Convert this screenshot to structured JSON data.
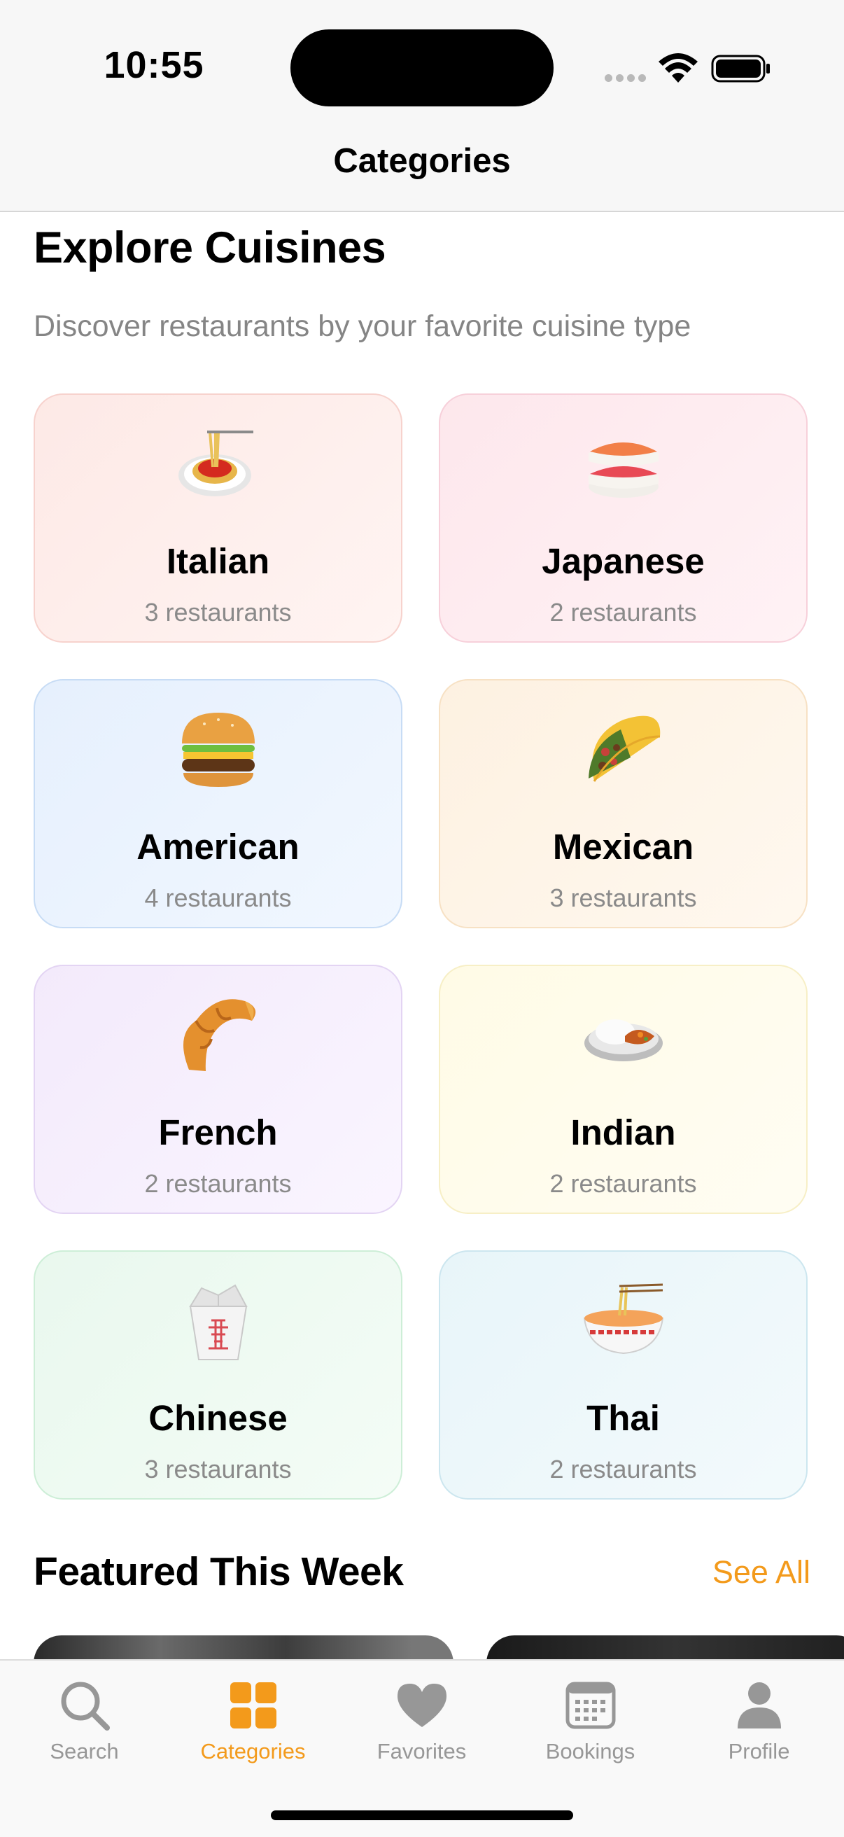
{
  "status_bar": {
    "time": "10:55"
  },
  "nav": {
    "title": "Categories"
  },
  "section": {
    "title": "Explore Cuisines",
    "subtitle": "Discover restaurants by your favorite cuisine type"
  },
  "cuisines": [
    {
      "name": "Italian",
      "count": "3 restaurants",
      "icon": "spaghetti-icon"
    },
    {
      "name": "Japanese",
      "count": "2 restaurants",
      "icon": "sushi-icon"
    },
    {
      "name": "American",
      "count": "4 restaurants",
      "icon": "hamburger-icon"
    },
    {
      "name": "Mexican",
      "count": "3 restaurants",
      "icon": "taco-icon"
    },
    {
      "name": "French",
      "count": "2 restaurants",
      "icon": "croissant-icon"
    },
    {
      "name": "Indian",
      "count": "2 restaurants",
      "icon": "curry-rice-icon"
    },
    {
      "name": "Chinese",
      "count": "3 restaurants",
      "icon": "takeout-box-icon"
    },
    {
      "name": "Thai",
      "count": "2 restaurants",
      "icon": "noodle-bowl-icon"
    }
  ],
  "featured": {
    "title": "Featured This Week",
    "see_all": "See All"
  },
  "tabs": [
    {
      "label": "Search",
      "icon": "search-icon"
    },
    {
      "label": "Categories",
      "icon": "grid-icon",
      "active": true
    },
    {
      "label": "Favorites",
      "icon": "heart-icon"
    },
    {
      "label": "Bookings",
      "icon": "calendar-icon"
    },
    {
      "label": "Profile",
      "icon": "person-icon"
    }
  ],
  "colors": {
    "accent": "#f39a1b",
    "inactive_tab": "#979797",
    "secondary_text": "#858585"
  }
}
